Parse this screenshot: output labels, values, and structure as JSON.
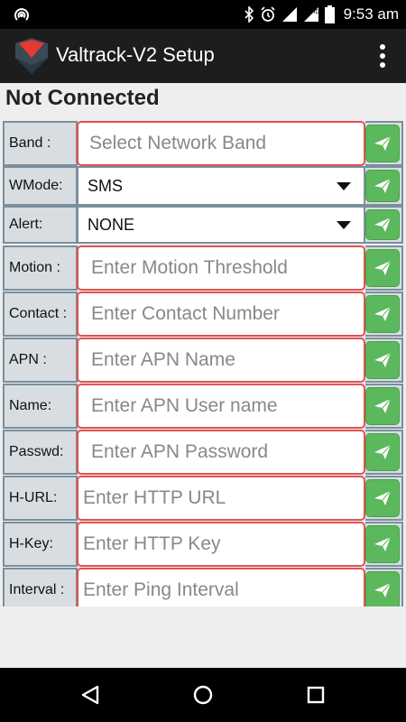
{
  "status_bar": {
    "time": "9:53 am",
    "left_icon": "hotspot-icon",
    "right_icons": [
      "bluetooth-icon",
      "alarm-icon",
      "signal-icon",
      "hd-signal-icon",
      "battery-icon"
    ]
  },
  "app_bar": {
    "title": "Valtrack-V2 Setup",
    "logo": "app-logo-icon",
    "menu_icon": "overflow-menu-icon"
  },
  "connection_status": "Not Connected",
  "colors": {
    "accent_green": "#5cb85c",
    "field_border": "#e05252",
    "label_bg": "#d8dde1"
  },
  "fields": [
    {
      "label": "Band :",
      "placeholder": "Select Network Band",
      "type": "input"
    },
    {
      "label": "WMode:",
      "value": "SMS",
      "type": "select"
    },
    {
      "label": "Alert:",
      "value": "NONE",
      "type": "select"
    },
    {
      "label": "Motion :",
      "placeholder": "Enter Motion Threshold",
      "type": "input"
    },
    {
      "label": "Contact :",
      "placeholder": "Enter Contact Number",
      "type": "input"
    },
    {
      "label": "APN :",
      "placeholder": "Enter APN Name",
      "type": "input"
    },
    {
      "label": "Name:",
      "placeholder": "Enter APN User name",
      "type": "input"
    },
    {
      "label": "Passwd:",
      "placeholder": "Enter APN Password",
      "type": "input"
    },
    {
      "label": "H-URL:",
      "placeholder": "Enter HTTP URL",
      "type": "input"
    },
    {
      "label": "H-Key:",
      "placeholder": "Enter HTTP Key",
      "type": "input"
    },
    {
      "label": "Interval :",
      "placeholder": "Enter Ping Interval",
      "type": "input"
    }
  ],
  "nav": [
    "back-icon",
    "home-icon",
    "recents-icon"
  ]
}
